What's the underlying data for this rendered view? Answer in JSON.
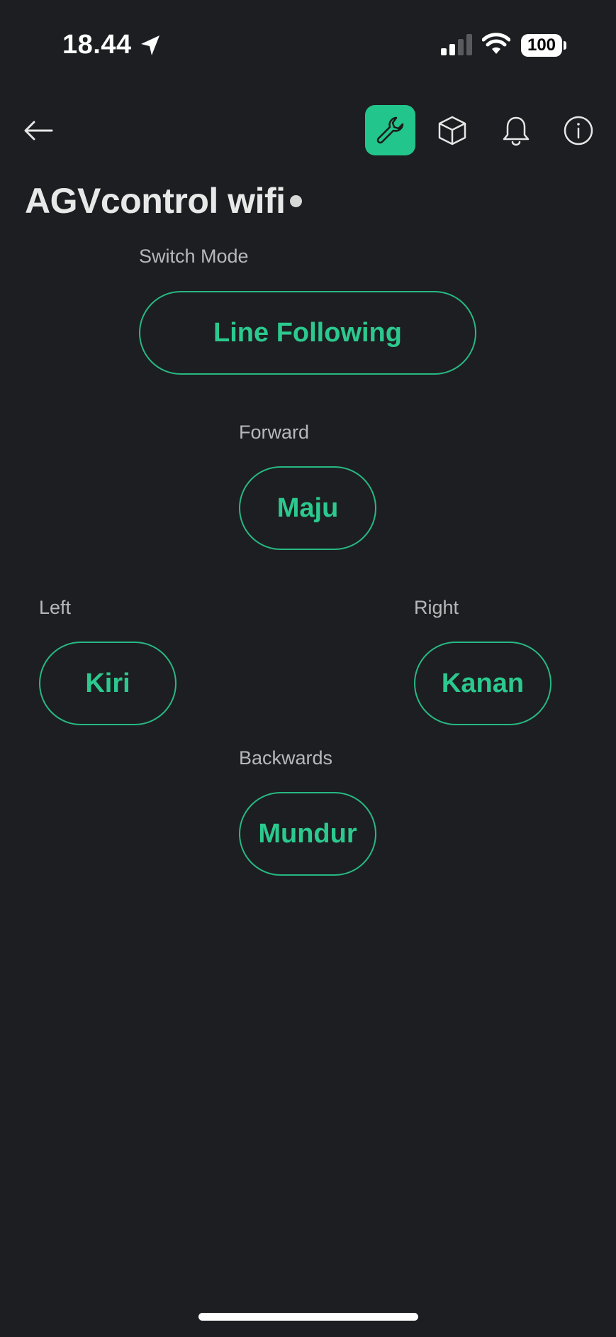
{
  "status_bar": {
    "time": "18.44",
    "battery": "100"
  },
  "toolbar": {
    "back_icon": "arrow-left-icon",
    "tools": [
      {
        "name": "wrench-icon",
        "active": true
      },
      {
        "name": "cube-icon",
        "active": false
      },
      {
        "name": "bell-icon",
        "active": false
      },
      {
        "name": "info-icon",
        "active": false
      }
    ]
  },
  "page": {
    "title": "AGVcontrol wifi"
  },
  "widgets": {
    "switch_mode": {
      "label": "Switch Mode",
      "button": "Line Following"
    },
    "forward": {
      "label": "Forward",
      "button": "Maju"
    },
    "left": {
      "label": "Left",
      "button": "Kiri"
    },
    "right": {
      "label": "Right",
      "button": "Kanan"
    },
    "backwards": {
      "label": "Backwards",
      "button": "Mundur"
    }
  },
  "colors": {
    "background": "#1d1e21",
    "accent": "#22c58b",
    "button_text": "#2cc98f",
    "label": "#b8b8bb"
  }
}
